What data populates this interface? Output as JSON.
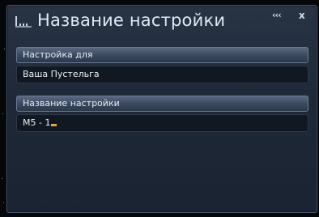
{
  "window": {
    "title": "Название настройки",
    "collapse_label": "‹‹‹",
    "close_label": "x"
  },
  "sections": {
    "setting_for": {
      "label": "Настройка для",
      "value": "Ваша Пустельга"
    },
    "setting_name": {
      "label": "Название настройки",
      "value": "M5 - 1"
    }
  },
  "colors": {
    "window_bg": "#1e2938",
    "header_bar": "#3c4a5f",
    "field_bg": "#111821",
    "cursor": "#e8a33a",
    "text": "#e6edf6"
  },
  "icons": {
    "title": "window-app-icon"
  }
}
